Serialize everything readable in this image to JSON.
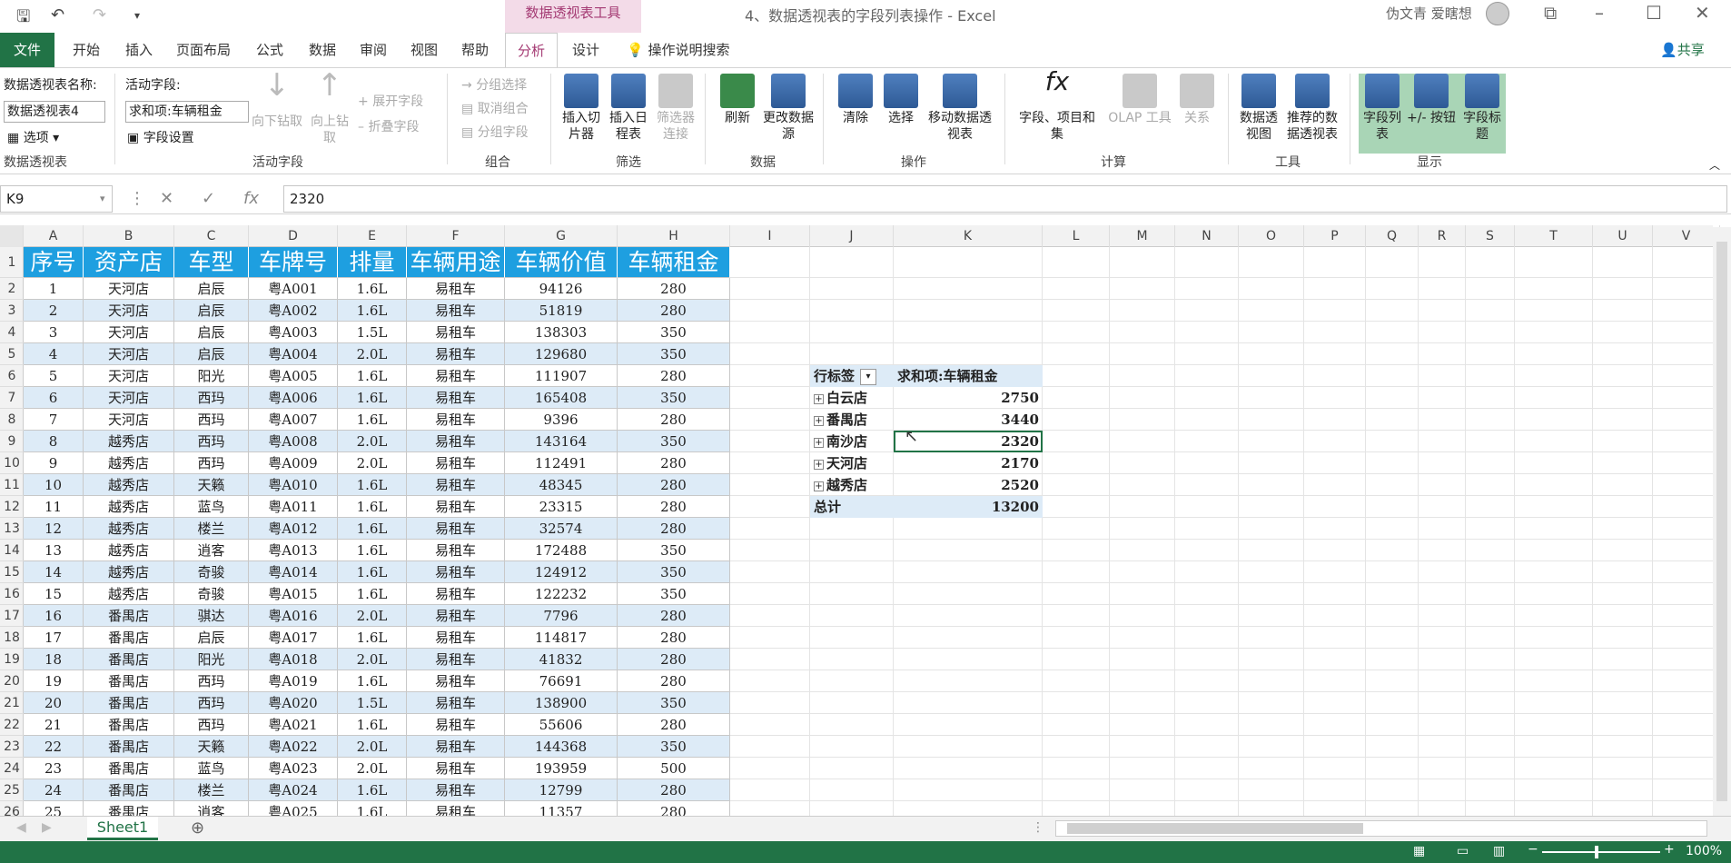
{
  "titlebar": {
    "context_tab_title": "数据透视表工具",
    "window_title": "4、数据透视表的字段列表操作 - Excel",
    "user_name": "伪文青 爱瞎想"
  },
  "tabs": {
    "file": "文件",
    "items": [
      "开始",
      "插入",
      "页面布局",
      "公式",
      "数据",
      "审阅",
      "视图",
      "帮助"
    ],
    "active": "分析",
    "design": "设计",
    "tell_me": "操作说明搜索",
    "share": "共享"
  },
  "ribbon": {
    "pivot_name_label": "数据透视表名称:",
    "pivot_name_value": "数据透视表4",
    "options_label": "选项",
    "group_pivot": "数据透视表",
    "active_field_label": "活动字段:",
    "active_field_value": "求和项:车辆租金",
    "field_settings": "字段设置",
    "drill_down": "向下钻取",
    "drill_up": "向上钻取",
    "expand_field": "展开字段",
    "collapse_field": "折叠字段",
    "group_active_field": "活动字段",
    "group_selection": "分组选择",
    "ungroup": "取消组合",
    "group_field": "分组字段",
    "group_group": "组合",
    "insert_slicer": "插入切片器",
    "insert_timeline": "插入日程表",
    "filter_connections": "筛选器连接",
    "group_filter": "筛选",
    "refresh": "刷新",
    "change_source": "更改数据源",
    "group_data": "数据",
    "clear": "清除",
    "select": "选择",
    "move_pivot": "移动数据透视表",
    "group_actions": "操作",
    "fields_items_sets": "字段、项目和集",
    "olap_tools": "OLAP 工具",
    "relationships": "关系",
    "group_calc": "计算",
    "pivot_chart": "数据透视图",
    "recommended": "推荐的数据透视表",
    "group_tools": "工具",
    "field_list": "字段列表",
    "buttons": "+/- 按钮",
    "field_headers": "字段标题",
    "group_show": "显示"
  },
  "formula": {
    "cell_ref": "K9",
    "value": "2320"
  },
  "columns": [
    "A",
    "B",
    "C",
    "D",
    "E",
    "F",
    "G",
    "H",
    "I",
    "J",
    "K",
    "L",
    "M",
    "N",
    "O",
    "P",
    "Q",
    "R",
    "S",
    "T",
    "U",
    "V"
  ],
  "rows": [
    "1",
    "2",
    "3",
    "4",
    "5",
    "6",
    "7",
    "8",
    "9",
    "10",
    "11",
    "12",
    "13",
    "14",
    "15",
    "16",
    "17",
    "18",
    "19",
    "20",
    "21",
    "22",
    "23",
    "24",
    "25",
    "26"
  ],
  "table": {
    "headers": [
      "序号",
      "资产店",
      "车型",
      "车牌号",
      "排量",
      "车辆用途",
      "车辆价值",
      "车辆租金"
    ],
    "rows": [
      [
        "1",
        "天河店",
        "启辰",
        "粤A001",
        "1.6L",
        "易租车",
        "94126",
        "280"
      ],
      [
        "2",
        "天河店",
        "启辰",
        "粤A002",
        "1.6L",
        "易租车",
        "51819",
        "280"
      ],
      [
        "3",
        "天河店",
        "启辰",
        "粤A003",
        "1.5L",
        "易租车",
        "138303",
        "350"
      ],
      [
        "4",
        "天河店",
        "启辰",
        "粤A004",
        "2.0L",
        "易租车",
        "129680",
        "350"
      ],
      [
        "5",
        "天河店",
        "阳光",
        "粤A005",
        "1.6L",
        "易租车",
        "111907",
        "280"
      ],
      [
        "6",
        "天河店",
        "西玛",
        "粤A006",
        "1.6L",
        "易租车",
        "165408",
        "350"
      ],
      [
        "7",
        "天河店",
        "西玛",
        "粤A007",
        "1.6L",
        "易租车",
        "9396",
        "280"
      ],
      [
        "8",
        "越秀店",
        "西玛",
        "粤A008",
        "2.0L",
        "易租车",
        "143164",
        "350"
      ],
      [
        "9",
        "越秀店",
        "西玛",
        "粤A009",
        "2.0L",
        "易租车",
        "112491",
        "280"
      ],
      [
        "10",
        "越秀店",
        "天籁",
        "粤A010",
        "1.6L",
        "易租车",
        "48345",
        "280"
      ],
      [
        "11",
        "越秀店",
        "蓝鸟",
        "粤A011",
        "1.6L",
        "易租车",
        "23315",
        "280"
      ],
      [
        "12",
        "越秀店",
        "楼兰",
        "粤A012",
        "1.6L",
        "易租车",
        "32574",
        "280"
      ],
      [
        "13",
        "越秀店",
        "逍客",
        "粤A013",
        "1.6L",
        "易租车",
        "172488",
        "350"
      ],
      [
        "14",
        "越秀店",
        "奇骏",
        "粤A014",
        "1.6L",
        "易租车",
        "124912",
        "350"
      ],
      [
        "15",
        "越秀店",
        "奇骏",
        "粤A015",
        "1.6L",
        "易租车",
        "122232",
        "350"
      ],
      [
        "16",
        "番禺店",
        "骐达",
        "粤A016",
        "2.0L",
        "易租车",
        "7796",
        "280"
      ],
      [
        "17",
        "番禺店",
        "启辰",
        "粤A017",
        "1.6L",
        "易租车",
        "114817",
        "280"
      ],
      [
        "18",
        "番禺店",
        "阳光",
        "粤A018",
        "2.0L",
        "易租车",
        "41832",
        "280"
      ],
      [
        "19",
        "番禺店",
        "西玛",
        "粤A019",
        "1.6L",
        "易租车",
        "76691",
        "280"
      ],
      [
        "20",
        "番禺店",
        "西玛",
        "粤A020",
        "1.5L",
        "易租车",
        "138900",
        "350"
      ],
      [
        "21",
        "番禺店",
        "西玛",
        "粤A021",
        "1.6L",
        "易租车",
        "55606",
        "280"
      ],
      [
        "22",
        "番禺店",
        "天籁",
        "粤A022",
        "2.0L",
        "易租车",
        "144368",
        "350"
      ],
      [
        "23",
        "番禺店",
        "蓝鸟",
        "粤A023",
        "2.0L",
        "易租车",
        "193959",
        "500"
      ],
      [
        "24",
        "番禺店",
        "楼兰",
        "粤A024",
        "1.6L",
        "易租车",
        "12799",
        "280"
      ],
      [
        "25",
        "番禺店",
        "逍客",
        "粤A025",
        "1.6L",
        "易租车",
        "11357",
        "280"
      ]
    ]
  },
  "pivot": {
    "row_label": "行标签",
    "value_label": "求和项:车辆租金",
    "items": [
      {
        "name": "白云店",
        "value": "2750"
      },
      {
        "name": "番禺店",
        "value": "3440"
      },
      {
        "name": "南沙店",
        "value": "2320"
      },
      {
        "name": "天河店",
        "value": "2170"
      },
      {
        "name": "越秀店",
        "value": "2520"
      }
    ],
    "total_label": "总计",
    "total_value": "13200"
  },
  "sheet": {
    "tab": "Sheet1"
  },
  "status": {
    "zoom": "100%"
  }
}
